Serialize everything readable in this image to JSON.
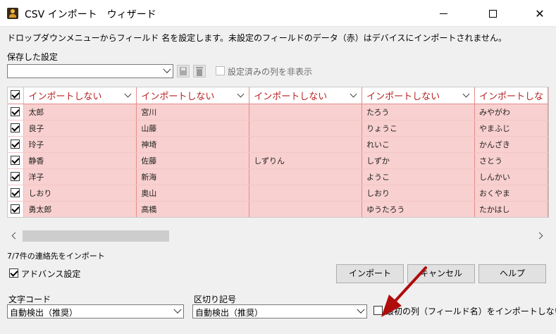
{
  "window": {
    "title": "CSV インポート　ウィザード"
  },
  "instruction": "ドロップダウンメニューからフィールド 名を設定します。未設定のフィールドのデータ（赤）はデバイスにインポートされません。",
  "saved_settings": {
    "label": "保存した設定",
    "value": "",
    "hide_mapped_label": "設定済みの列を非表示",
    "hide_mapped_checked": false
  },
  "grid": {
    "header_checked": true,
    "columns": [
      {
        "field": "インポートしない"
      },
      {
        "field": "インポートしない"
      },
      {
        "field": "インポートしない"
      },
      {
        "field": "インポートしない"
      },
      {
        "field": "インポートしな"
      }
    ],
    "rows": [
      {
        "checked": true,
        "cells": [
          "太郎",
          "宮川",
          "",
          "たろう",
          "みやがわ"
        ]
      },
      {
        "checked": true,
        "cells": [
          "良子",
          "山藤",
          "",
          "りょうこ",
          "やまふじ"
        ]
      },
      {
        "checked": true,
        "cells": [
          "玲子",
          "神埼",
          "",
          "れいこ",
          "かんざき"
        ]
      },
      {
        "checked": true,
        "cells": [
          "静香",
          "佐藤",
          "しずりん",
          "しずか",
          "さとう"
        ]
      },
      {
        "checked": true,
        "cells": [
          "洋子",
          "新海",
          "",
          "ようこ",
          "しんかい"
        ]
      },
      {
        "checked": true,
        "cells": [
          "しおり",
          "奥山",
          "",
          "しおり",
          "おくやま"
        ]
      },
      {
        "checked": true,
        "cells": [
          "勇太郎",
          "高橋",
          "",
          "ゆうたろう",
          "たかはし"
        ]
      }
    ]
  },
  "status": "7/7件の連絡先をインポート",
  "advanced": {
    "label": "アドバンス設定",
    "checked": true
  },
  "buttons": {
    "import": "インポート",
    "cancel": "キャンセル",
    "help": "ヘルプ"
  },
  "char_code": {
    "label": "文字コード",
    "value": "自動検出（推奨）"
  },
  "delimiter": {
    "label": "区切り記号",
    "value": "自動検出（推奨）"
  },
  "skip_first_row": {
    "label": "最初の列（フィールド名）をインポートしない",
    "checked": false
  },
  "colors": {
    "unmapped_cell": "#f8d0cf",
    "header_text": "#b81e1e",
    "annotation_arrow": "#b00c0c"
  }
}
